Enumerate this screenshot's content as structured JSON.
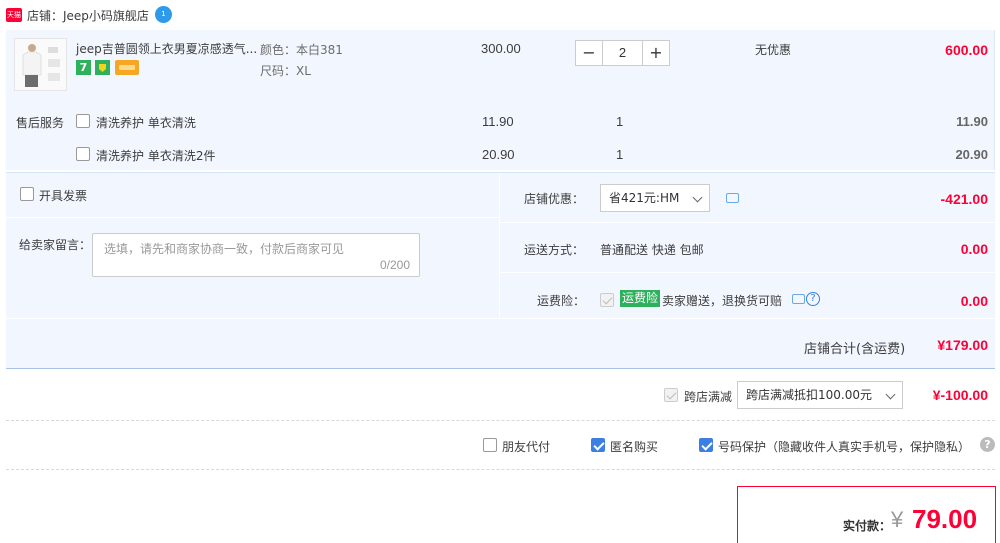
{
  "shop": {
    "badge": "天猫",
    "name": "店铺：Jeep小码旗舰店",
    "chat_badge": "1"
  },
  "item": {
    "title": "jeep吉普圆领上衣男夏凉感透气...",
    "spec_color": "颜色：本白381",
    "spec_size": "尺码：XL",
    "price": "300.00",
    "quantity": "2",
    "minus": "−",
    "plus": "+",
    "discount": "无优惠",
    "total": "600.00",
    "badge_7": "7"
  },
  "after_sale": {
    "label": "售后服务",
    "services": [
      {
        "name": "清洗养护 单衣清洗",
        "price": "11.90",
        "qty": "1",
        "total": "11.90"
      },
      {
        "name": "清洗养护 单衣清洗2件",
        "price": "20.90",
        "qty": "1",
        "total": "20.90"
      }
    ]
  },
  "invoice": {
    "label": "开具发票"
  },
  "message": {
    "label": "给卖家留言：",
    "placeholder": "选填，请先和商家协商一致，付款后商家可见",
    "counter": "0/200"
  },
  "shop_discount": {
    "label": "店铺优惠：",
    "selected": "省421元:HM",
    "amount": "-421.00"
  },
  "shipping": {
    "label": "运送方式：",
    "method": "普通配送 快递 包邮",
    "amount": "0.00"
  },
  "insurance": {
    "label": "运费险：",
    "tag": "运费险",
    "desc": "卖家赠送，退换货可赔",
    "amount": "0.00"
  },
  "shop_total": {
    "label": "店铺合计(含运费)",
    "amount": "¥179.00"
  },
  "cross_store": {
    "label": "跨店满减",
    "selected": "跨店满减抵扣100.00元",
    "amount": "¥-100.00"
  },
  "options": {
    "friend_pay": "朋友代付",
    "anonymous": "匿名购买",
    "number_protect": "号码保护（隐藏收件人真实手机号，保护隐私）"
  },
  "payment": {
    "label": "实付款：",
    "currency": "¥",
    "amount": "79.00"
  },
  "colors": {
    "accent_red": "#ff0036",
    "panel_bg": "#f2f7ff",
    "check_blue": "#3d7fe0",
    "tag_green": "#2fb05d"
  }
}
